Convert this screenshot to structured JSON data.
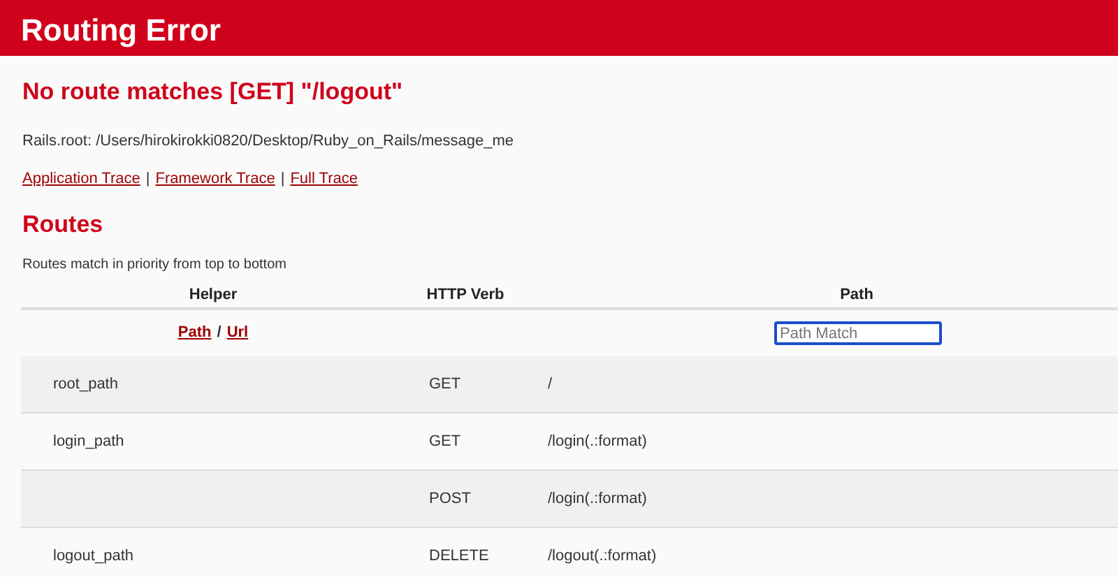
{
  "header": {
    "title": "Routing Error"
  },
  "error_message": "No route matches [GET] \"/logout\"",
  "rails_root": "Rails.root: /Users/hirokirokki0820/Desktop/Ruby_on_Rails/message_me",
  "trace_links": [
    {
      "label": "Application Trace"
    },
    {
      "label": "Framework Trace"
    },
    {
      "label": "Full Trace"
    }
  ],
  "trace_separator": "|",
  "routes_heading": "Routes",
  "routes_note": "Routes match in priority from top to bottom",
  "table": {
    "columns": [
      "Helper",
      "HTTP Verb",
      "Path"
    ],
    "filter": {
      "links": [
        "Path",
        "Url"
      ],
      "separator": "/",
      "placeholder": "Path Match"
    },
    "rows": [
      {
        "helper": "root_path",
        "verb": "GET",
        "path": "/"
      },
      {
        "helper": "login_path",
        "verb": "GET",
        "path": "/login(.:format)"
      },
      {
        "helper": "",
        "verb": "POST",
        "path": "/login(.:format)"
      },
      {
        "helper": "logout_path",
        "verb": "DELETE",
        "path": "/logout(.:format)"
      }
    ]
  }
}
